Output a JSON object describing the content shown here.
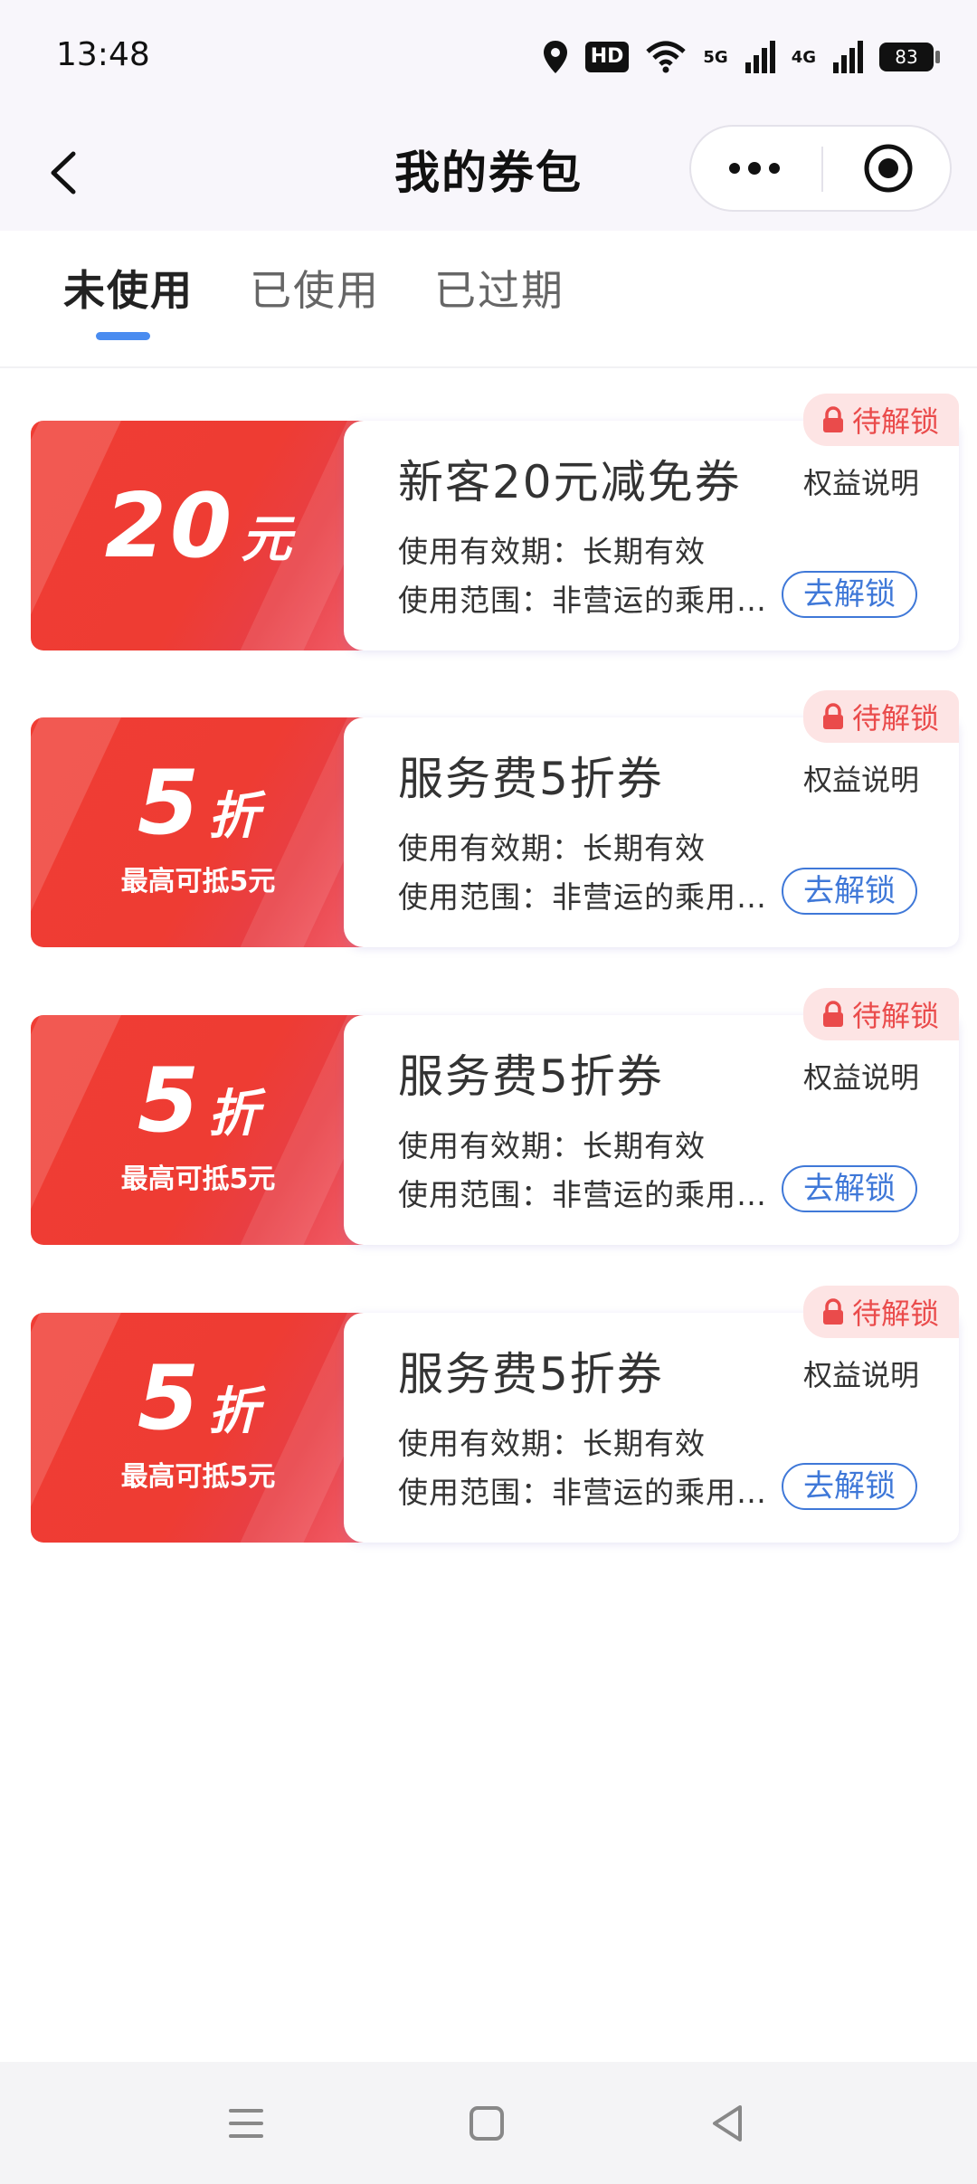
{
  "status_bar": {
    "time": "13:48",
    "hd_label": "HD",
    "net1_label": "5G",
    "net2_label": "4G",
    "battery_level": "83",
    "icons": [
      "location-icon",
      "wifi-icon",
      "signal-icon",
      "battery-icon"
    ]
  },
  "nav": {
    "title": "我的券包",
    "icons": [
      "back-icon",
      "more-icon",
      "close-mini-program-icon"
    ]
  },
  "tabs": [
    {
      "label": "未使用",
      "active": true
    },
    {
      "label": "已使用",
      "active": false
    },
    {
      "label": "已过期",
      "active": false
    }
  ],
  "coupons": [
    {
      "value": "20",
      "unit": "元",
      "subtitle": "",
      "badge": "待解锁",
      "name": "新客20元减免券",
      "rights_link": "权益说明",
      "validity": "使用有效期：长期有效",
      "scope": "使用范围：非营运的乘用…",
      "button": "去解锁"
    },
    {
      "value": "5",
      "unit": "折",
      "subtitle": "最高可抵5元",
      "badge": "待解锁",
      "name": "服务费5折券",
      "rights_link": "权益说明",
      "validity": "使用有效期：长期有效",
      "scope": "使用范围：非营运的乘用…",
      "button": "去解锁"
    },
    {
      "value": "5",
      "unit": "折",
      "subtitle": "最高可抵5元",
      "badge": "待解锁",
      "name": "服务费5折券",
      "rights_link": "权益说明",
      "validity": "使用有效期：长期有效",
      "scope": "使用范围：非营运的乘用…",
      "button": "去解锁"
    },
    {
      "value": "5",
      "unit": "折",
      "subtitle": "最高可抵5元",
      "badge": "待解锁",
      "name": "服务费5折券",
      "rights_link": "权益说明",
      "validity": "使用有效期：长期有效",
      "scope": "使用范围：非营运的乘用…",
      "button": "去解锁"
    }
  ],
  "system_nav": {
    "icons": [
      "menu-icon",
      "home-icon",
      "back-triangle-icon"
    ]
  },
  "colors": {
    "coupon_red": "#ef3d35",
    "badge_bg": "#fde4e4",
    "badge_text": "#ea4b4b",
    "accent_blue": "#3f78d8",
    "tab_indicator": "#4a8cf0"
  }
}
